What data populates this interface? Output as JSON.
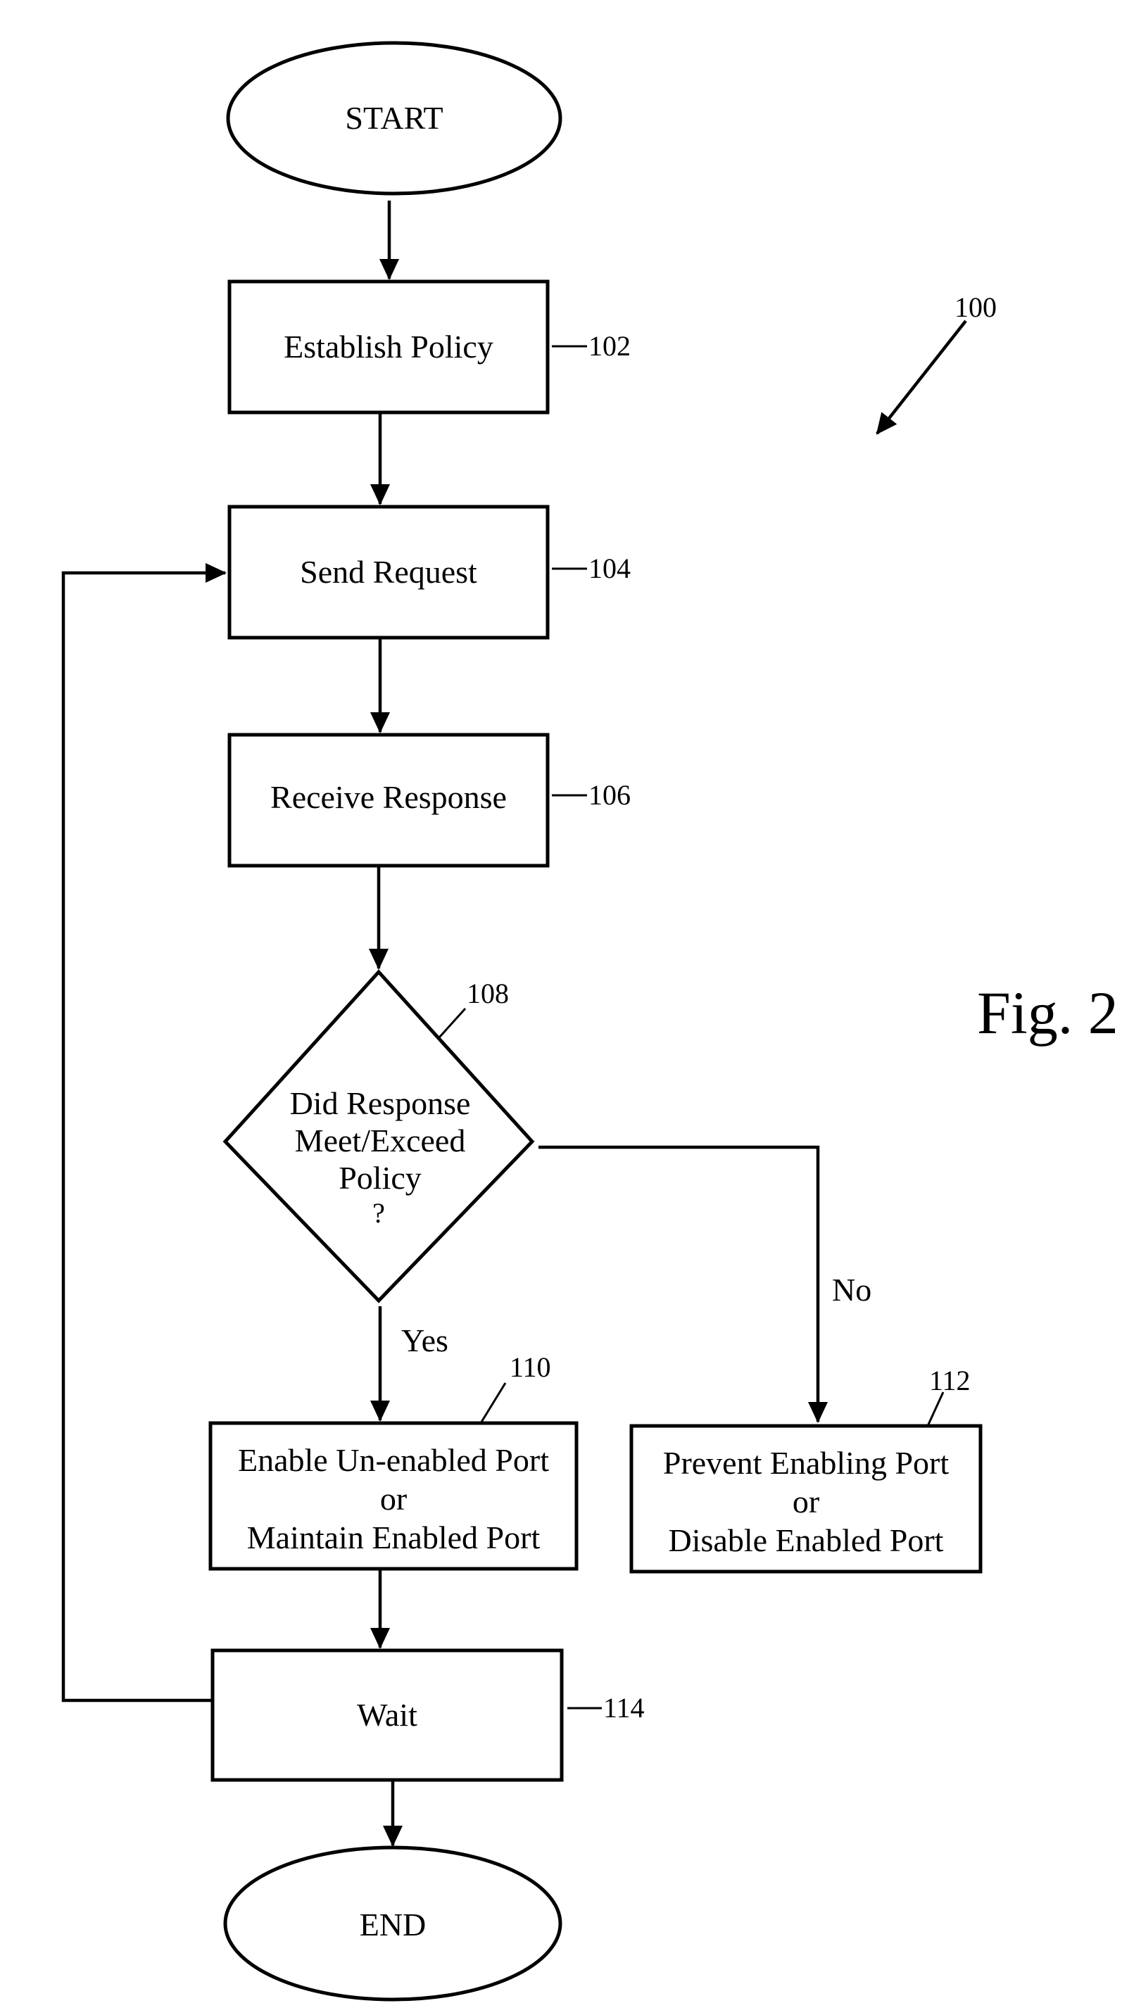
{
  "figure": {
    "title": "Fig. 2",
    "reference": "100"
  },
  "nodes": {
    "start": {
      "text": "START"
    },
    "establish_policy": {
      "text": "Establish Policy",
      "ref": "102"
    },
    "send_request": {
      "text": "Send Request",
      "ref": "104"
    },
    "receive_response": {
      "text": "Receive Response",
      "ref": "106"
    },
    "decision": {
      "lines": [
        "Did Response",
        "Meet/Exceed",
        "Policy",
        "?"
      ],
      "ref": "108"
    },
    "enable_port": {
      "lines": [
        "Enable Un-enabled Port",
        "or",
        "Maintain Enabled Port"
      ],
      "ref": "110"
    },
    "prevent_port": {
      "lines": [
        "Prevent Enabling Port",
        "or",
        "Disable Enabled Port"
      ],
      "ref": "112"
    },
    "wait": {
      "text": "Wait",
      "ref": "114"
    },
    "end": {
      "text": "END"
    }
  },
  "branches": {
    "yes": "Yes",
    "no": "No"
  }
}
